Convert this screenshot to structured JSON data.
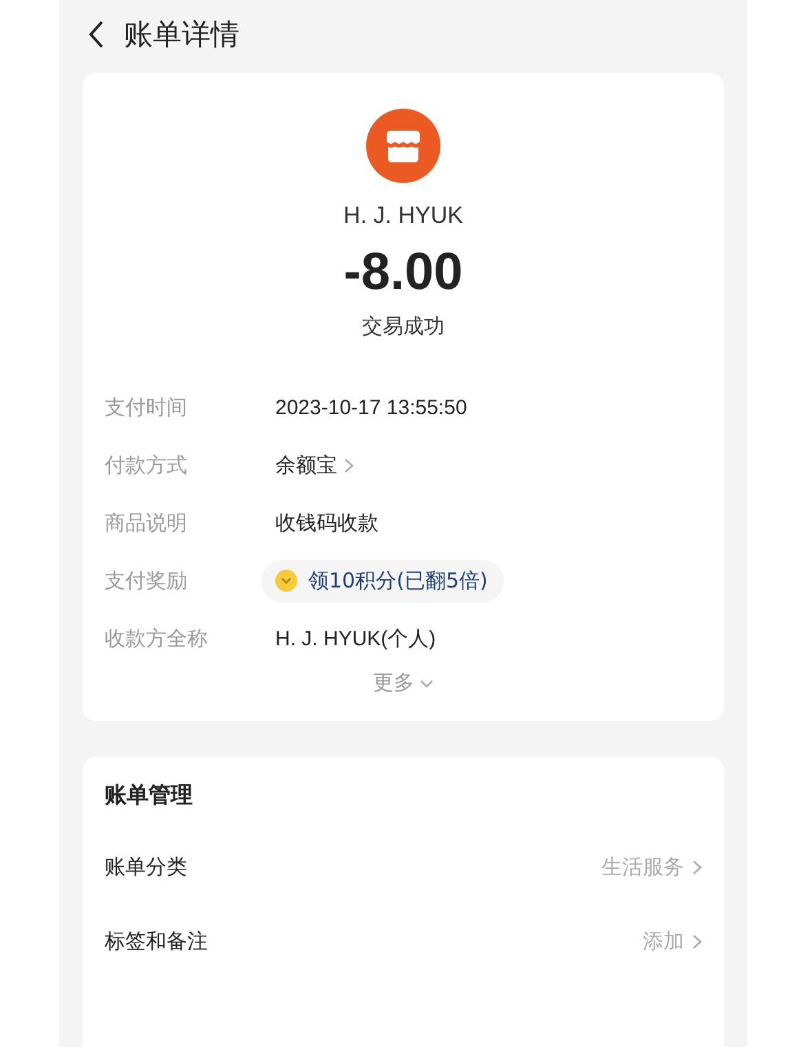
{
  "header": {
    "title": "账单详情"
  },
  "summary": {
    "payee": "H. J. HYUK",
    "amount": "-8.00",
    "status": "交易成功"
  },
  "details": [
    {
      "kind": "text",
      "label": "支付时间",
      "value": "2023-10-17 13:55:50"
    },
    {
      "kind": "link",
      "label": "付款方式",
      "value": "余额宝"
    },
    {
      "kind": "text",
      "label": "商品说明",
      "value": "收钱码收款"
    },
    {
      "kind": "reward",
      "label": "支付奖励",
      "value": "领10积分(已翻5倍)"
    },
    {
      "kind": "text",
      "label": "收款方全称",
      "value": "H. J. HYUK(个人)"
    }
  ],
  "more": "更多",
  "management": {
    "title": "账单管理",
    "rows": [
      {
        "label": "账单分类",
        "value": "生活服务"
      },
      {
        "label": "标签和备注",
        "value": "添加"
      }
    ]
  }
}
